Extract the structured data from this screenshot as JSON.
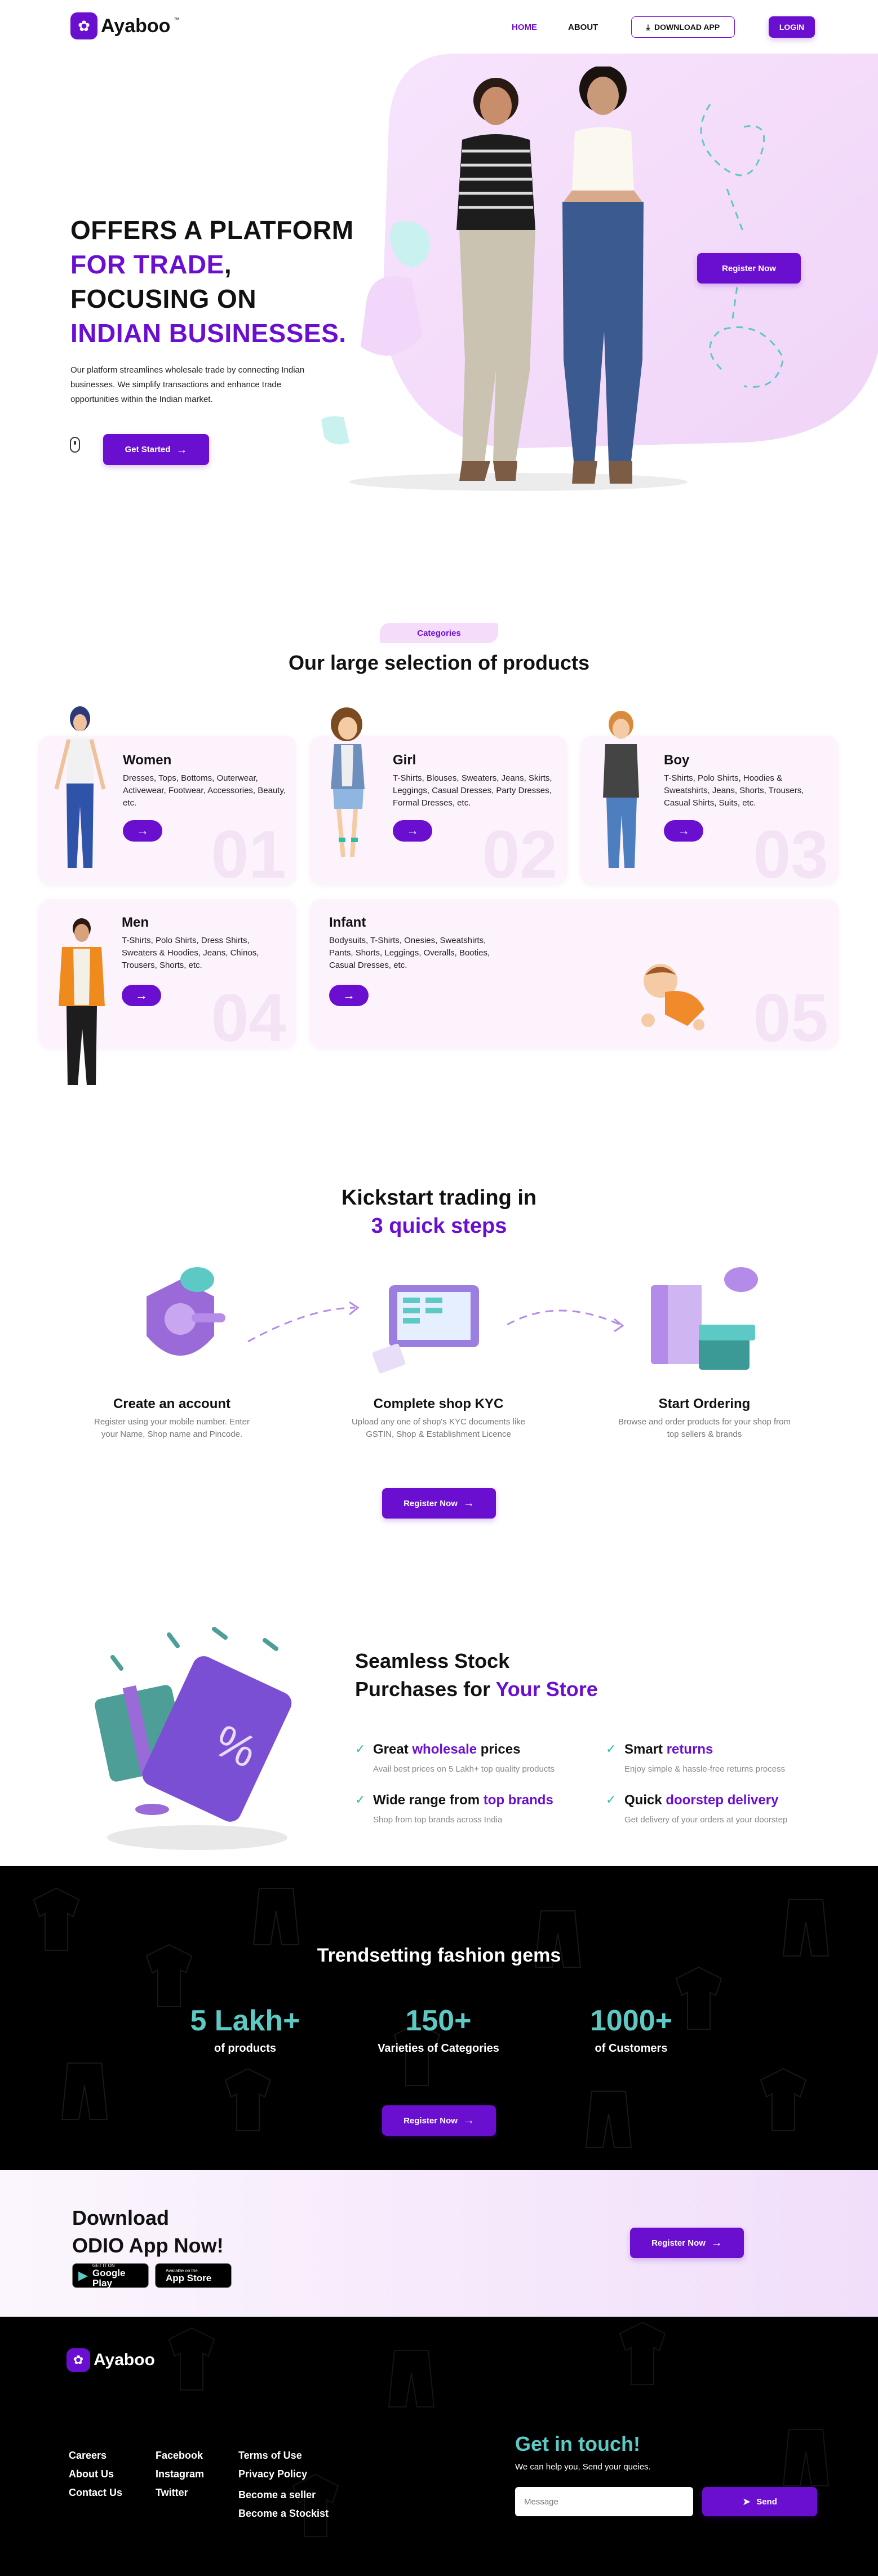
{
  "brand": {
    "name": "Ayaboo",
    "tm": "™"
  },
  "nav": {
    "home": "HOME",
    "about": "ABOUT",
    "download": "DOWNLOAD APP",
    "login": "LOGIN"
  },
  "hero": {
    "line1": "OFFERS A PLATFORM",
    "line2": "FOR TRADE",
    "comma": ",",
    "line3": "FOCUSING ON",
    "line4": "INDIAN BUSINESSES.",
    "desc": "Our platform streamlines wholesale trade by connecting Indian businesses. We simplify transactions and enhance trade opportunities within the Indian market.",
    "cta": "Get Started",
    "register": "Register Now"
  },
  "categories": {
    "pill": "Categories",
    "heading": "Our large selection of products",
    "items": [
      {
        "title": "Women",
        "desc": "Dresses, Tops, Bottoms,  Outerwear, Activewear, Footwear, Accessories, Beauty, etc.",
        "num": "01"
      },
      {
        "title": "Girl",
        "desc": "T-Shirts, Blouses, Sweaters, Jeans, Skirts, Leggings, Casual Dresses, Party Dresses, Formal Dresses, etc.",
        "num": "02"
      },
      {
        "title": "Boy",
        "desc": "T-Shirts, Polo Shirts, Hoodies & Sweatshirts, Jeans, Shorts, Trousers, Casual Shirts, Suits, etc.",
        "num": "03"
      },
      {
        "title": "Men",
        "desc": "T-Shirts, Polo Shirts, Dress Shirts, Sweaters & Hoodies, Jeans, Chinos, Trousers, Shorts, etc.",
        "num": "04"
      },
      {
        "title": "Infant",
        "desc": "Bodysuits, T-Shirts, Onesies, Sweatshirts, Pants, Shorts, Leggings, Overalls, Booties, Casual Dresses, etc.",
        "num": "05"
      }
    ]
  },
  "steps": {
    "heading1": "Kickstart trading in",
    "heading2": "3 quick steps",
    "register": "Register Now",
    "items": [
      {
        "title": "Create an account",
        "desc": "Register using your mobile number. Enter your Name, Shop name and Pincode."
      },
      {
        "title": "Complete shop KYC",
        "desc": "Upload any one of shop's KYC documents like GSTIN, Shop & Establishment Licence"
      },
      {
        "title": "Start Ordering",
        "desc": "Browse and order products for your shop from top sellers & brands"
      }
    ]
  },
  "seamless": {
    "h1": "Seamless Stock",
    "h2a": "Purchases for ",
    "h2b": "Your Store",
    "features": [
      {
        "pre": "Great ",
        "hl": "wholesale",
        "post": " prices",
        "desc": "Avail best prices on 5 Lakh+ top quality products"
      },
      {
        "pre": "Smart ",
        "hl": "returns",
        "post": "",
        "desc": "Enjoy simple & hassle-free returns process"
      },
      {
        "pre": "Wide range from ",
        "hl": "top brands",
        "post": "",
        "desc": "Shop from top brands across India"
      },
      {
        "pre": "Quick ",
        "hl": "doorstep delivery",
        "post": "",
        "desc": "Get delivery of your orders at your doorstep"
      }
    ]
  },
  "stats": {
    "heading": "Trendsetting fashion gems",
    "register": "Register Now",
    "items": [
      {
        "value": "5 Lakh+",
        "label": "of products"
      },
      {
        "value": "150+",
        "label": "Varieties of Categories"
      },
      {
        "value": "1000+",
        "label": "of Customers"
      }
    ]
  },
  "download": {
    "line1": "Download",
    "line2": "ODIO App Now!",
    "register": "Register Now",
    "google": {
      "small": "GET IT ON",
      "big": "Google Play"
    },
    "apple": {
      "small": "Available on the",
      "big": "App Store"
    }
  },
  "footer": {
    "col1": [
      "Careers",
      "About Us",
      "Contact Us"
    ],
    "col2": [
      "Facebook",
      "Instagram",
      "Twitter"
    ],
    "col3": [
      "Terms of Use",
      "Privacy Policy",
      "Become a seller",
      "Become a Stockist"
    ],
    "touch": "Get in touch!",
    "touch_sub": "We can help you, Send your queies.",
    "placeholder": "Message",
    "send": "Send"
  },
  "colors": {
    "primary": "#6a0fd0",
    "teal": "#5cc9c4",
    "lavender": "#f5dcfb"
  },
  "icons": [
    "download-icon",
    "arrow-right-icon",
    "check-icon",
    "send-icon",
    "mouse-icon",
    "google-play-icon",
    "apple-icon"
  ]
}
